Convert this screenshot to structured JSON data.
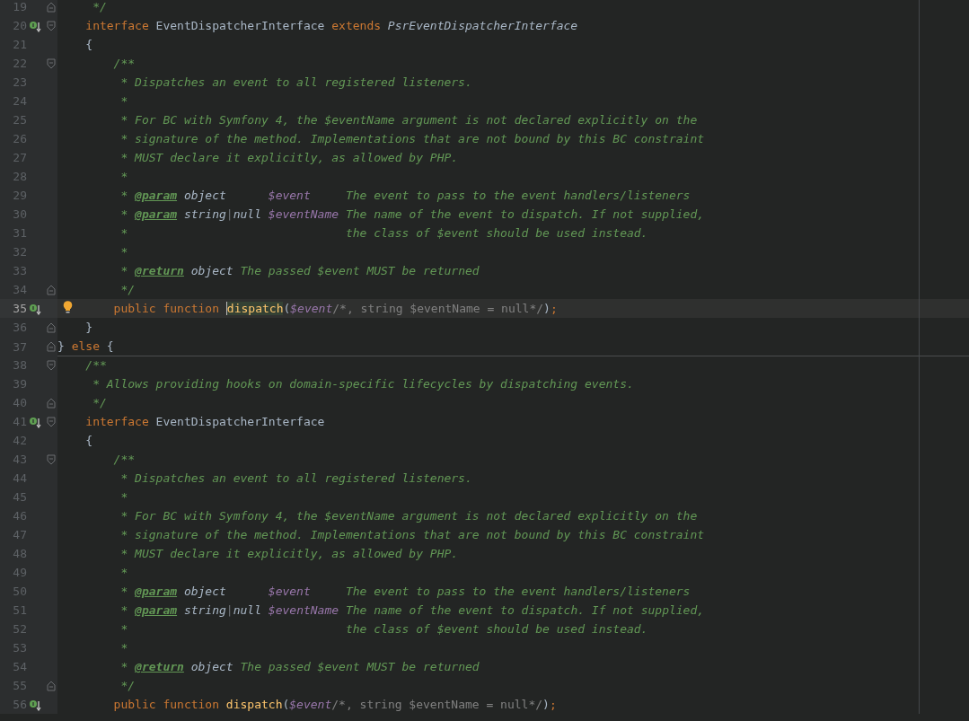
{
  "editor": {
    "lines": [
      {
        "number": "19",
        "fold": {
          "kind": "close"
        },
        "tokens": [
          {
            "kind": "doc",
            "text": "     */"
          }
        ]
      },
      {
        "number": "20",
        "marker": {
          "kind": "implements"
        },
        "fold": {
          "kind": "open"
        },
        "tokens": [
          {
            "kind": "kw",
            "text": "    interface"
          },
          {
            "kind": "plain",
            "text": " EventDispatcherInterface "
          },
          {
            "kind": "kw",
            "text": "extends"
          },
          {
            "kind": "italic",
            "text": " PsrEventDispatcherInterface"
          }
        ]
      },
      {
        "number": "21",
        "tokens": [
          {
            "kind": "plain",
            "text": "    {"
          }
        ]
      },
      {
        "number": "22",
        "fold": {
          "kind": "open"
        },
        "tokens": [
          {
            "kind": "doc",
            "text": "        /**"
          }
        ]
      },
      {
        "number": "23",
        "tokens": [
          {
            "kind": "doc",
            "text": "         * Dispatches an event to all registered listeners."
          }
        ]
      },
      {
        "number": "24",
        "tokens": [
          {
            "kind": "doc",
            "text": "         *"
          }
        ]
      },
      {
        "number": "25",
        "tokens": [
          {
            "kind": "doc",
            "text": "         * For BC with Symfony 4, the $eventName argument is not declared explicitly on the"
          }
        ]
      },
      {
        "number": "26",
        "tokens": [
          {
            "kind": "doc",
            "text": "         * signature of the method. Implementations that are not bound by this BC constraint"
          }
        ]
      },
      {
        "number": "27",
        "tokens": [
          {
            "kind": "doc",
            "text": "         * MUST declare it explicitly, as allowed by PHP."
          }
        ]
      },
      {
        "number": "28",
        "tokens": [
          {
            "kind": "doc",
            "text": "         *"
          }
        ]
      },
      {
        "number": "29",
        "tokens": [
          {
            "kind": "doc",
            "text": "         * "
          },
          {
            "kind": "tag",
            "text": "@param"
          },
          {
            "kind": "type",
            "text": " object      "
          },
          {
            "kind": "var",
            "text": "$event"
          },
          {
            "kind": "doc",
            "text": "     The event to pass to the event handlers/listeners"
          }
        ]
      },
      {
        "number": "30",
        "tokens": [
          {
            "kind": "doc",
            "text": "         * "
          },
          {
            "kind": "tag",
            "text": "@param"
          },
          {
            "kind": "type",
            "text": " string"
          },
          {
            "kind": "pipe",
            "text": "|"
          },
          {
            "kind": "type",
            "text": "null "
          },
          {
            "kind": "var",
            "text": "$eventName"
          },
          {
            "kind": "doc",
            "text": " The name of the event to dispatch. If not supplied,"
          }
        ]
      },
      {
        "number": "31",
        "tokens": [
          {
            "kind": "doc",
            "text": "         *                               the class of $event should be used instead."
          }
        ]
      },
      {
        "number": "32",
        "tokens": [
          {
            "kind": "doc",
            "text": "         *"
          }
        ]
      },
      {
        "number": "33",
        "tokens": [
          {
            "kind": "doc",
            "text": "         * "
          },
          {
            "kind": "tag",
            "text": "@return"
          },
          {
            "kind": "type",
            "text": " object"
          },
          {
            "kind": "doc",
            "text": " The passed $event MUST be returned"
          }
        ]
      },
      {
        "number": "34",
        "fold": {
          "kind": "close"
        },
        "tokens": [
          {
            "kind": "doc",
            "text": "         */"
          }
        ]
      },
      {
        "number": "35",
        "marker": {
          "kind": "implements"
        },
        "current": true,
        "intention": true,
        "tokens": [
          {
            "kind": "kw",
            "text": "        public function "
          },
          {
            "kind": "fn",
            "text": "dispatch",
            "highlighted": true
          },
          {
            "kind": "plain",
            "text": "("
          },
          {
            "kind": "var",
            "text": "$event"
          },
          {
            "kind": "cmt",
            "text": "/*, string $eventName = null*/"
          },
          {
            "kind": "plain",
            "text": ")"
          },
          {
            "kind": "kw",
            "text": ";"
          }
        ]
      },
      {
        "number": "36",
        "fold": {
          "kind": "close"
        },
        "tokens": [
          {
            "kind": "plain",
            "text": "    }"
          }
        ]
      },
      {
        "number": "37",
        "fold": {
          "kind": "close"
        },
        "separator": true,
        "tokens": [
          {
            "kind": "plain",
            "text": "} "
          },
          {
            "kind": "kw",
            "text": "else"
          },
          {
            "kind": "plain",
            "text": " {"
          }
        ]
      },
      {
        "number": "38",
        "fold": {
          "kind": "open"
        },
        "tokens": [
          {
            "kind": "doc",
            "text": "    /**"
          }
        ]
      },
      {
        "number": "39",
        "tokens": [
          {
            "kind": "doc",
            "text": "     * Allows providing hooks on domain-specific lifecycles by dispatching events."
          }
        ]
      },
      {
        "number": "40",
        "fold": {
          "kind": "close"
        },
        "tokens": [
          {
            "kind": "doc",
            "text": "     */"
          }
        ]
      },
      {
        "number": "41",
        "marker": {
          "kind": "implements"
        },
        "fold": {
          "kind": "open"
        },
        "tokens": [
          {
            "kind": "kw",
            "text": "    interface"
          },
          {
            "kind": "plain",
            "text": " EventDispatcherInterface"
          }
        ]
      },
      {
        "number": "42",
        "tokens": [
          {
            "kind": "plain",
            "text": "    {"
          }
        ]
      },
      {
        "number": "43",
        "fold": {
          "kind": "open"
        },
        "tokens": [
          {
            "kind": "doc",
            "text": "        /**"
          }
        ]
      },
      {
        "number": "44",
        "tokens": [
          {
            "kind": "doc",
            "text": "         * Dispatches an event to all registered listeners."
          }
        ]
      },
      {
        "number": "45",
        "tokens": [
          {
            "kind": "doc",
            "text": "         *"
          }
        ]
      },
      {
        "number": "46",
        "tokens": [
          {
            "kind": "doc",
            "text": "         * For BC with Symfony 4, the $eventName argument is not declared explicitly on the"
          }
        ]
      },
      {
        "number": "47",
        "tokens": [
          {
            "kind": "doc",
            "text": "         * signature of the method. Implementations that are not bound by this BC constraint"
          }
        ]
      },
      {
        "number": "48",
        "tokens": [
          {
            "kind": "doc",
            "text": "         * MUST declare it explicitly, as allowed by PHP."
          }
        ]
      },
      {
        "number": "49",
        "tokens": [
          {
            "kind": "doc",
            "text": "         *"
          }
        ]
      },
      {
        "number": "50",
        "tokens": [
          {
            "kind": "doc",
            "text": "         * "
          },
          {
            "kind": "tag",
            "text": "@param"
          },
          {
            "kind": "type",
            "text": " object      "
          },
          {
            "kind": "var",
            "text": "$event"
          },
          {
            "kind": "doc",
            "text": "     The event to pass to the event handlers/listeners"
          }
        ]
      },
      {
        "number": "51",
        "tokens": [
          {
            "kind": "doc",
            "text": "         * "
          },
          {
            "kind": "tag",
            "text": "@param"
          },
          {
            "kind": "type",
            "text": " string"
          },
          {
            "kind": "pipe",
            "text": "|"
          },
          {
            "kind": "type",
            "text": "null "
          },
          {
            "kind": "var",
            "text": "$eventName"
          },
          {
            "kind": "doc",
            "text": " The name of the event to dispatch. If not supplied,"
          }
        ]
      },
      {
        "number": "52",
        "tokens": [
          {
            "kind": "doc",
            "text": "         *                               the class of $event should be used instead."
          }
        ]
      },
      {
        "number": "53",
        "tokens": [
          {
            "kind": "doc",
            "text": "         *"
          }
        ]
      },
      {
        "number": "54",
        "tokens": [
          {
            "kind": "doc",
            "text": "         * "
          },
          {
            "kind": "tag",
            "text": "@return"
          },
          {
            "kind": "type",
            "text": " object"
          },
          {
            "kind": "doc",
            "text": " The passed $event MUST be returned"
          }
        ]
      },
      {
        "number": "55",
        "fold": {
          "kind": "close"
        },
        "tokens": [
          {
            "kind": "doc",
            "text": "         */"
          }
        ]
      },
      {
        "number": "56",
        "marker": {
          "kind": "implements"
        },
        "tokens": [
          {
            "kind": "kw",
            "text": "        public function "
          },
          {
            "kind": "fn",
            "text": "dispatch"
          },
          {
            "kind": "plain",
            "text": "("
          },
          {
            "kind": "var",
            "text": "$event"
          },
          {
            "kind": "cmt",
            "text": "/*, string $eventName = null*/"
          },
          {
            "kind": "plain",
            "text": ")"
          },
          {
            "kind": "kw",
            "text": ";"
          }
        ]
      }
    ]
  }
}
